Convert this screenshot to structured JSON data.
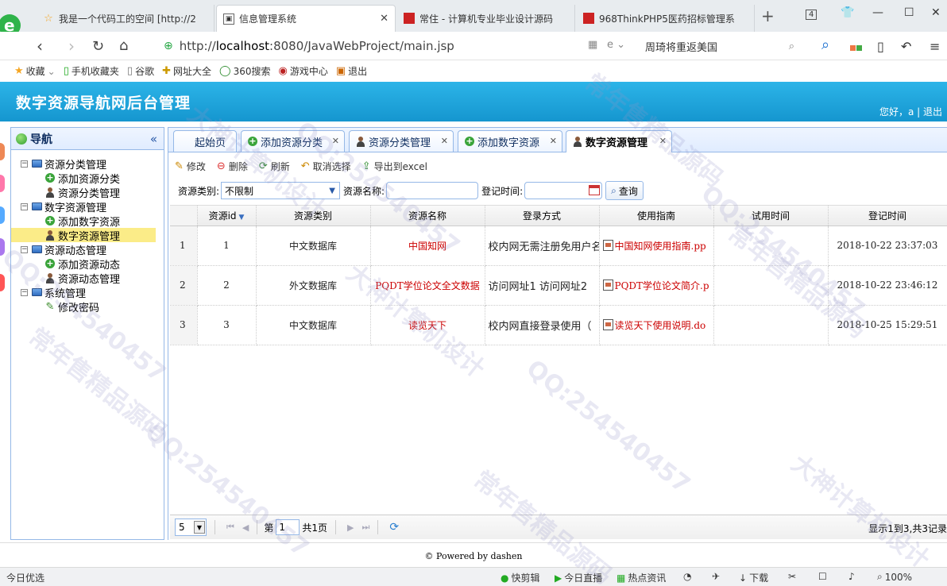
{
  "browser": {
    "tabs": [
      {
        "title": "我是一个代码工的空间 [http://2"
      },
      {
        "title": "信息管理系统"
      },
      {
        "title": "常住 - 计算机专业毕业设计源码"
      },
      {
        "title": "968ThinkPHP5医药招标管理系"
      }
    ],
    "tab_count": "4",
    "url_prefix": "http://",
    "url_host": "localhost",
    "url_rest": ":8080/JavaWebProject/main.jsp",
    "search_value": "周琦将重返美国",
    "bookmarks": [
      "收藏",
      "手机收藏夹",
      "谷歌",
      "网址大全",
      "360搜索",
      "游戏中心",
      "退出"
    ]
  },
  "app": {
    "title": "数字资源导航网后台管理",
    "greeting": "您好，a | 退出"
  },
  "nav": {
    "title": "导航",
    "collapse": "«",
    "groups": [
      {
        "label": "资源分类管理",
        "items": [
          "添加资源分类",
          "资源分类管理"
        ]
      },
      {
        "label": "数字资源管理",
        "items": [
          "添加数字资源",
          "数字资源管理"
        ]
      },
      {
        "label": "资源动态管理",
        "items": [
          "添加资源动态",
          "资源动态管理"
        ]
      },
      {
        "label": "系统管理",
        "items": [
          "修改密码"
        ]
      }
    ]
  },
  "panel_tabs": [
    {
      "label": "起始页"
    },
    {
      "label": "添加资源分类"
    },
    {
      "label": "资源分类管理"
    },
    {
      "label": "添加数字资源"
    },
    {
      "label": "数字资源管理"
    }
  ],
  "toolbar": {
    "edit": "修改",
    "delete": "删除",
    "refresh": "刷新",
    "unselect": "取消选择",
    "export": "导出到excel"
  },
  "filters": {
    "type_label": "资源类别:",
    "type_value": "不限制",
    "name_label": "资源名称:",
    "time_label": "登记时间:",
    "query": "查询"
  },
  "grid": {
    "columns": [
      "资源id",
      "资源类别",
      "资源名称",
      "登录方式",
      "使用指南",
      "试用时间",
      "登记时间"
    ],
    "rows": [
      {
        "rownum": "1",
        "id": "1",
        "type": "中文数据库",
        "name": "中国知网",
        "login": "校内网无需注册免用户名",
        "guide": "中国知网使用指南.pp",
        "trial": "",
        "time": "2018-10-22 23:37:03"
      },
      {
        "rownum": "2",
        "id": "2",
        "type": "外文数据库",
        "name": "PQDT学位论文全文数据",
        "login": "访问网址1 访问网址2",
        "guide": "PQDT学位论文简介.p",
        "trial": "",
        "time": "2018-10-22 23:46:12"
      },
      {
        "rownum": "3",
        "id": "3",
        "type": "中文数据库",
        "name": "读览天下",
        "login": "校内网直接登录使用（",
        "guide": "读览天下使用说明.do",
        "trial": "",
        "time": "2018-10-25 15:29:51"
      }
    ]
  },
  "pager": {
    "page_size": "5",
    "page_label_before": "第",
    "page_value": "1",
    "page_label_after": "共1页",
    "info": "显示1到3,共3记录"
  },
  "footer": "© Powered by dashen",
  "statusbar": {
    "left": "今日优选",
    "items": [
      "快剪辑",
      "今日直播",
      "热点资讯",
      "下载",
      "100%"
    ]
  },
  "watermarks": [
    "QQ:254540457",
    "大神计算机设计",
    "常年售精品源码"
  ]
}
